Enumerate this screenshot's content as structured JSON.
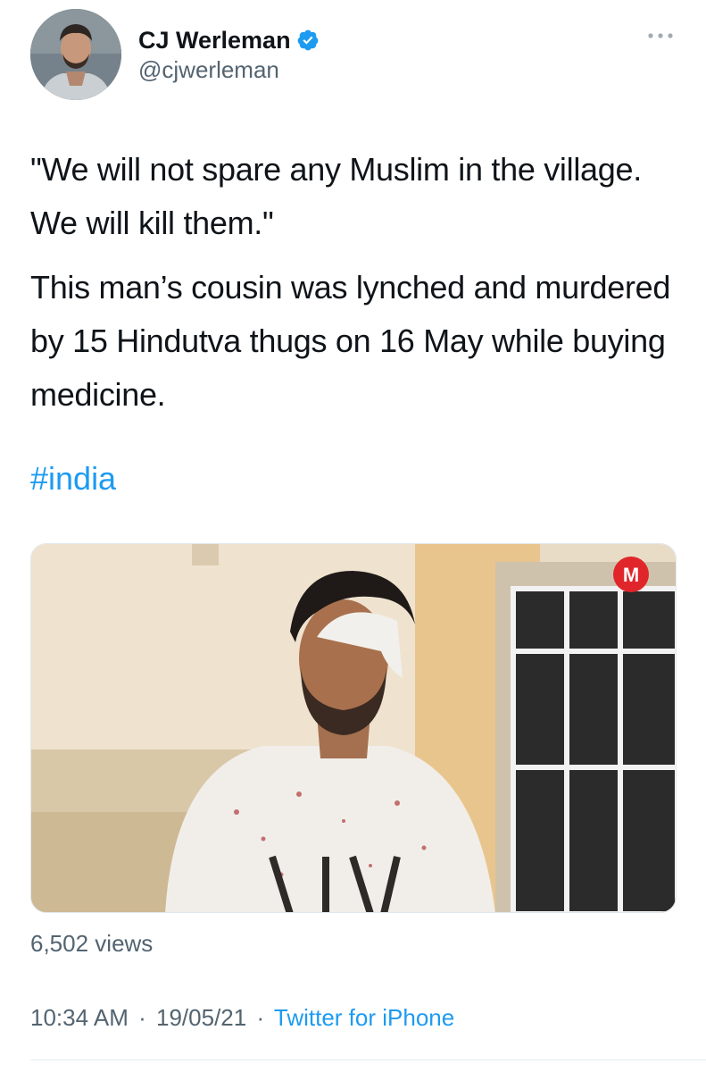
{
  "tweet": {
    "author": {
      "display_name": "CJ Werleman",
      "handle": "@cjwerleman",
      "verified": true,
      "verified_icon": "verified-badge-icon",
      "avatar_icon": "avatar"
    },
    "more_icon": "more-horizontal-icon",
    "text_paragraphs": [
      "\"We will not spare any Muslim in the village. We will kill them.\"",
      "This man’s cousin was lynched and murdered by 15 Hindutva thugs on 16 May while buying medicine."
    ],
    "hashtag": "#india",
    "media": {
      "type": "video",
      "channel_logo_text": "M",
      "channel_logo_color": "#e0262b"
    },
    "views": "6,502 views",
    "time": "10:34 AM",
    "separator": "·",
    "date": "19/05/21",
    "source": "Twitter for iPhone"
  },
  "colors": {
    "link": "#1d9bf0",
    "secondary_text": "#536471",
    "primary_text": "#0f1419",
    "divider": "#e6ecf0"
  }
}
